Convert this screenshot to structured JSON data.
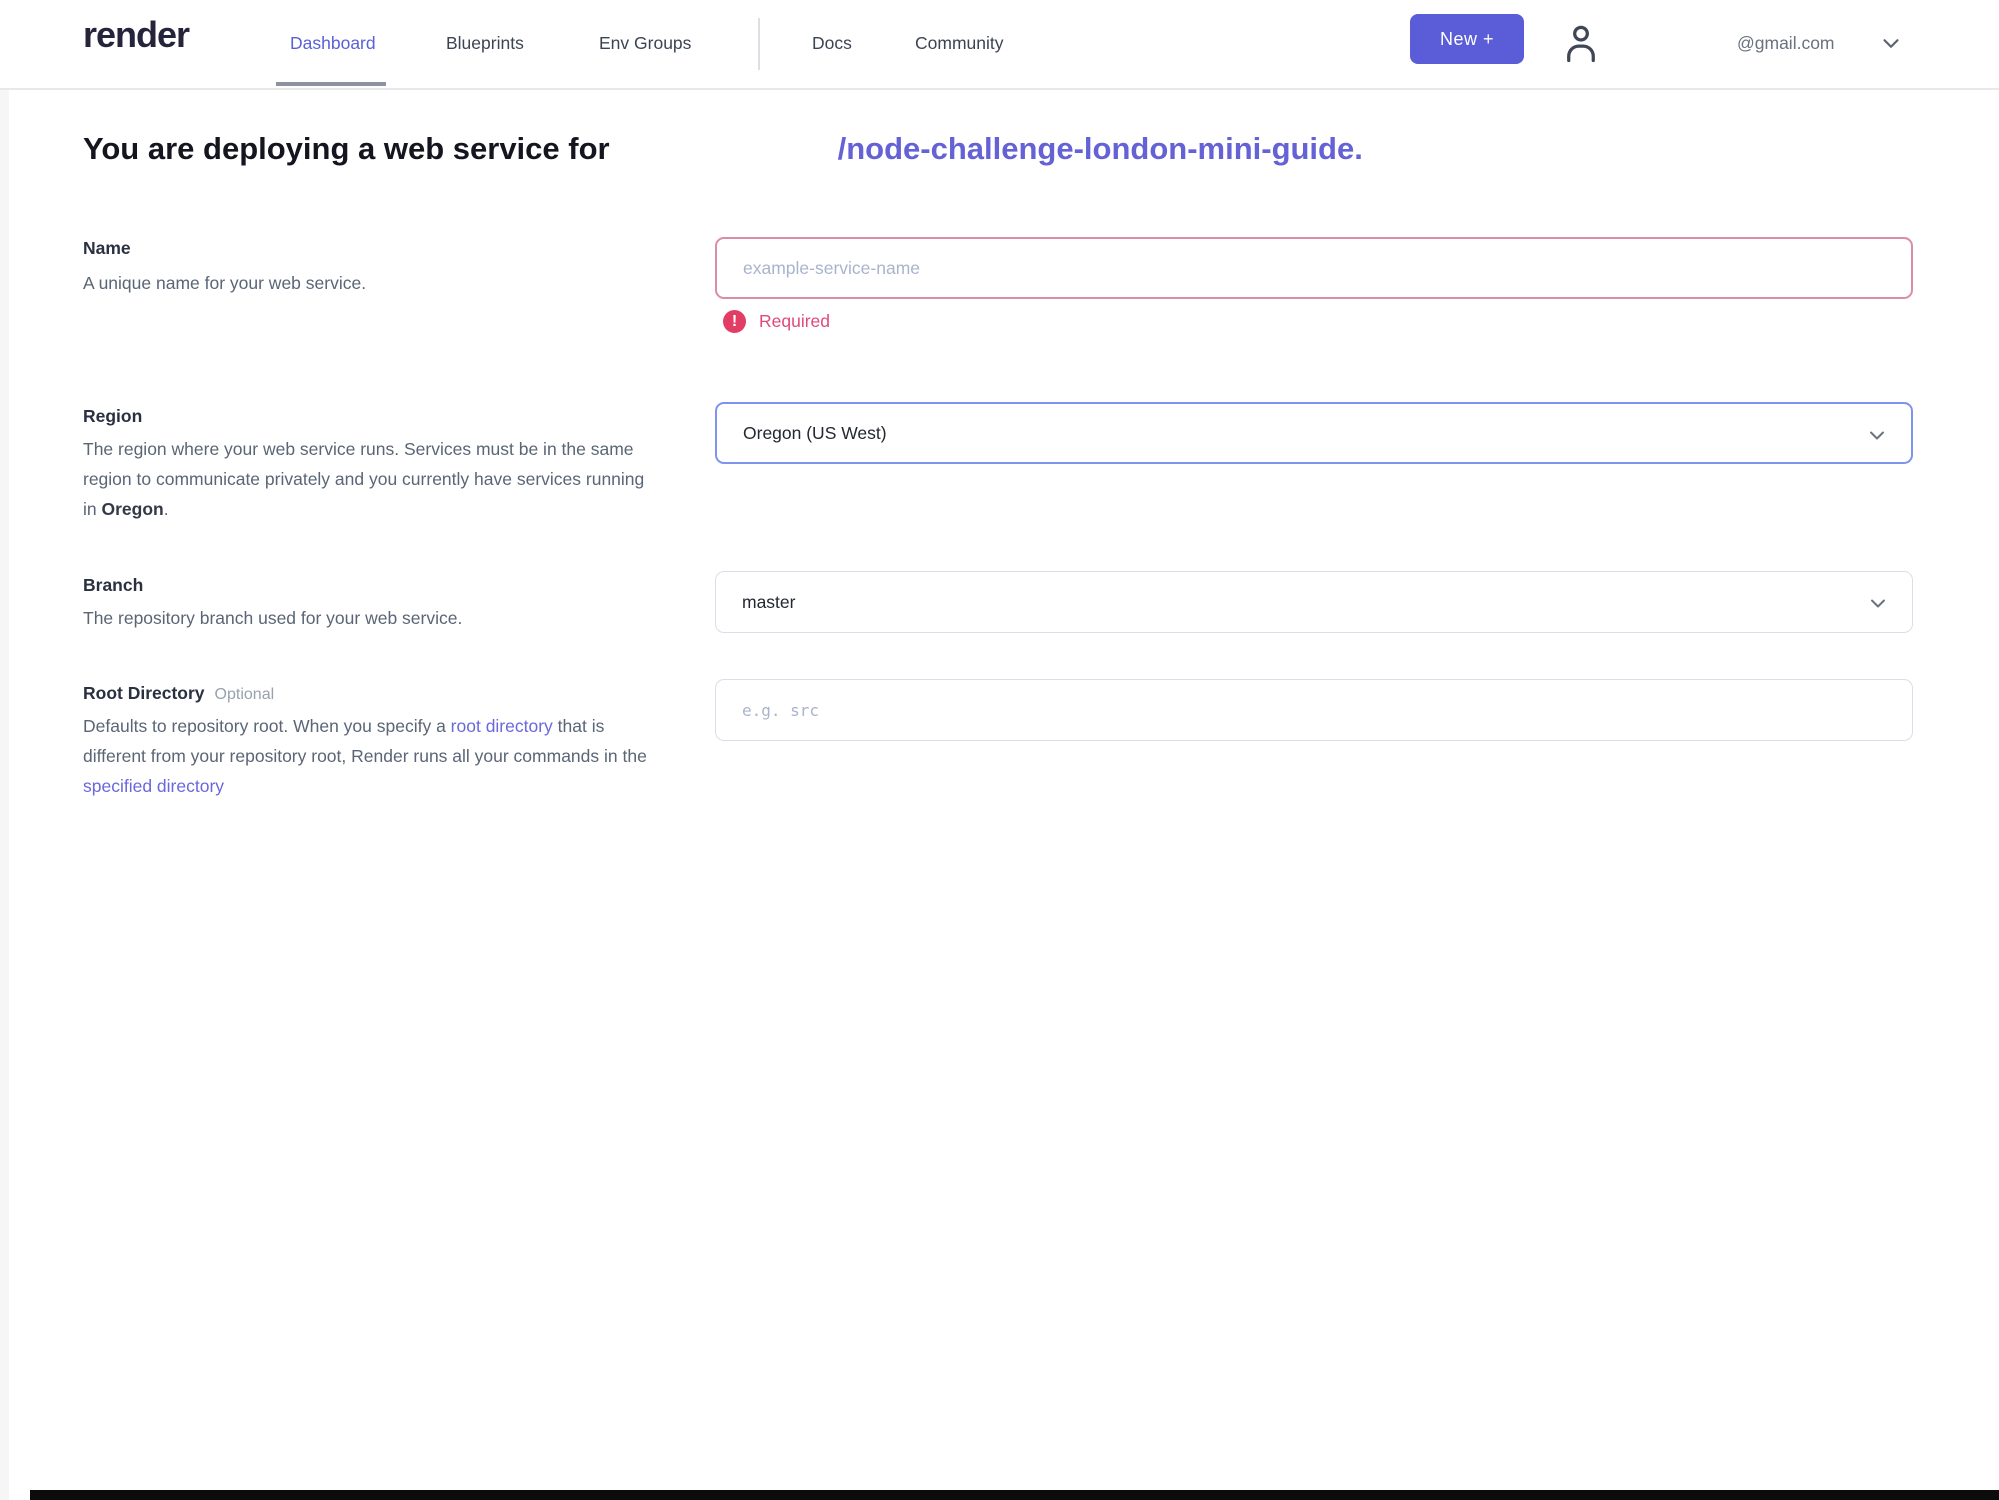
{
  "header": {
    "logo_text": "render",
    "nav_items": [
      {
        "label": "Dashboard",
        "active": true
      },
      {
        "label": "Blueprints",
        "active": false
      },
      {
        "label": "Env Groups",
        "active": false
      },
      {
        "label": "Docs",
        "active": false
      },
      {
        "label": "Community",
        "active": false
      }
    ],
    "new_button_label": "New +",
    "account_email": "@gmail.com",
    "icons": {
      "user_icon": "person-outline",
      "account_chevron_icon": "chevron-down",
      "select_chevron_icon": "chevron-down",
      "error_icon": "exclamation-circle"
    }
  },
  "heading": {
    "text_before": "You are deploying a web service for",
    "repo_link": "/node-challenge-london-mini-guide."
  },
  "form": {
    "name": {
      "label": "Name",
      "description": "A unique name for your web service.",
      "placeholder": "example-service-name",
      "value": "",
      "error": "Required"
    },
    "region": {
      "label": "Region",
      "description_before": "The region where your web service runs. Services must be in the same region to communicate privately and you currently have services running in ",
      "description_bold": "Oregon",
      "description_after": ".",
      "value": "Oregon (US West)"
    },
    "branch": {
      "label": "Branch",
      "description": "The repository branch used for your web service.",
      "value": "master"
    },
    "root_directory": {
      "label": "Root Directory",
      "optional_tag": "Optional",
      "description_part1": "Defaults to repository root. When you specify a ",
      "link1": "root directory",
      "description_part2": " that is different from your repository root, Render runs all your commands in the ",
      "link2": "specified directory",
      "placeholder": "e.g. src",
      "value": ""
    }
  },
  "colors": {
    "accent_indigo": "#5a5cd8",
    "active_nav": "#5a60d6",
    "heading_link_purple": "#6462d4",
    "desc_link_purple": "#6b67dd",
    "error_pink": "#e0497a",
    "error_icon_red": "#e23d64",
    "error_border_pink": "#db8ca8",
    "focused_border_blue": "#7e93f0",
    "input_border_gray": "#d9dee8"
  }
}
